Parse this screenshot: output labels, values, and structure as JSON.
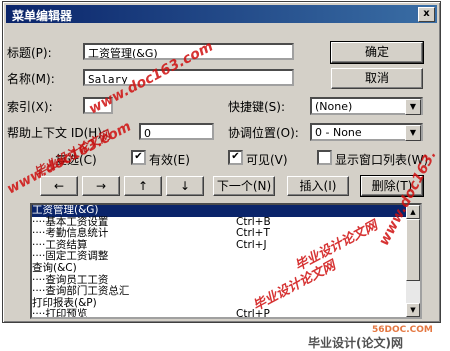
{
  "window": {
    "title": "菜单编辑器",
    "close": "x"
  },
  "form": {
    "caption_label": "标题(P):",
    "caption_value": "工资管理(&G)",
    "name_label": "名称(M):",
    "name_value": "Salary",
    "index_label": "索引(X):",
    "index_value": "",
    "shortcut_label": "快捷键(S):",
    "shortcut_value": "(None)",
    "help_label": "帮助上下文 ID(H):",
    "help_value": "0",
    "negotiate_label": "协调位置(O):",
    "negotiate_value": "0 - None",
    "checked_label": "复选(C)",
    "enabled_label": "有效(E)",
    "enabled_checked": true,
    "visible_label": "可见(V)",
    "visible_checked": true,
    "windowlist_label": "显示窗口列表(W)",
    "windowlist_checked": false
  },
  "buttons": {
    "ok": "确定",
    "cancel": "取消",
    "left": "←",
    "right": "→",
    "up": "↑",
    "down": "↓",
    "next": "下一个(N)",
    "insert": "插入(I)",
    "delete": "删除(T)"
  },
  "menu_items": [
    {
      "text": "工资管理(&G)",
      "shortcut": "",
      "selected": true
    },
    {
      "text": "····基本工资设置",
      "shortcut": "Ctrl+B",
      "selected": false
    },
    {
      "text": "····考勤信息统计",
      "shortcut": "Ctrl+T",
      "selected": false
    },
    {
      "text": "····工资结算",
      "shortcut": "Ctrl+J",
      "selected": false
    },
    {
      "text": "····固定工资调整",
      "shortcut": "",
      "selected": false
    },
    {
      "text": "查询(&C)",
      "shortcut": "",
      "selected": false
    },
    {
      "text": "····查询员工工资",
      "shortcut": "",
      "selected": false
    },
    {
      "text": "····查询部门工资总汇",
      "shortcut": "",
      "selected": false
    },
    {
      "text": "打印报表(&P)",
      "shortcut": "",
      "selected": false
    },
    {
      "text": "····打印预览",
      "shortcut": "Ctrl+P",
      "selected": false
    }
  ],
  "watermarks": {
    "w1": "www.doc163.com",
    "w2": "毕业设计论文网",
    "w3": "www.doc163.com",
    "w4": "毕业设计论文网",
    "w5": "www.doc163.",
    "w6": "毕业设计论文网",
    "w7": "56DOC.COM",
    "w8": "毕业设计(论文)网"
  },
  "colors": {
    "titlebar": "#0a246a",
    "selection": "#0a246a",
    "face": "#d4d0c8"
  }
}
